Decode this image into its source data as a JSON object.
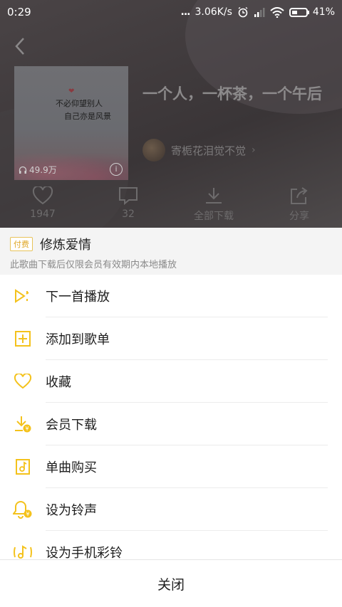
{
  "status_bar": {
    "time": "0:29",
    "dots": "...",
    "speed": "3.06K/s",
    "battery": "41%",
    "battery_level": 0.41,
    "icons": [
      "alarm-icon",
      "signal-icon",
      "wifi-icon",
      "battery-icon"
    ]
  },
  "playlist": {
    "title": "一个人，一杯茶，一个午后",
    "creator": "寄栀花泪觉不觉",
    "cover_text_line1": "不必仰望别人",
    "cover_text_line2": "自己亦是风景",
    "plays": "49.9万",
    "actions": [
      {
        "icon": "heart-icon",
        "label": "1947"
      },
      {
        "icon": "comment-icon",
        "label": "32"
      },
      {
        "icon": "download-icon",
        "label": "全部下载"
      },
      {
        "icon": "share-icon",
        "label": "分享"
      }
    ]
  },
  "sheet": {
    "badge": "付费",
    "song_title": "修炼爱情",
    "note": "此歌曲下载后仅限会员有效期内本地播放",
    "menu": [
      {
        "icon": "play-next-icon",
        "label": "下一首播放"
      },
      {
        "icon": "add-to-playlist-icon",
        "label": "添加到歌单"
      },
      {
        "icon": "heart-icon",
        "label": "收藏"
      },
      {
        "icon": "vip-download-icon",
        "label": "会员下载"
      },
      {
        "icon": "buy-song-icon",
        "label": "单曲购买"
      },
      {
        "icon": "ringtone-icon",
        "label": "设为铃声"
      },
      {
        "icon": "phone-ringback-icon",
        "label": "设为手机彩铃"
      }
    ],
    "close_label": "关闭"
  },
  "colors": {
    "accent": "#f4c21c",
    "dim_background": "#3d3839",
    "sheet_header": "#f4f4f4"
  }
}
